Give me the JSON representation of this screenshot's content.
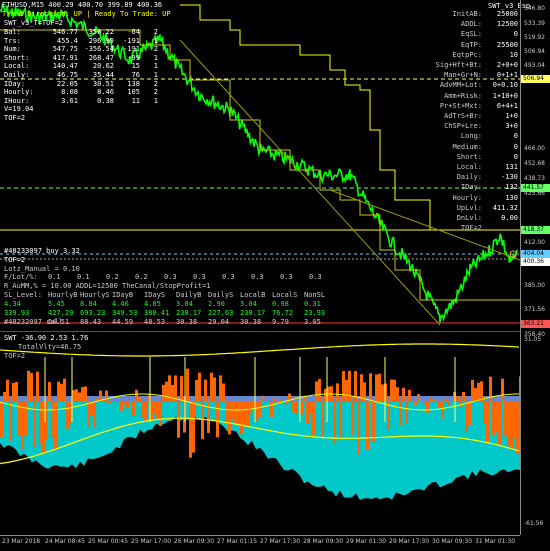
{
  "header": {
    "symbol_line": "ETHUSD,M15  400.29 400.70 399.89 400.36",
    "trend_line": "Trend Direction:  UP  |  Ready To Trade:  UP",
    "indicator_tag": "SWT_v3_Esp"
  },
  "left_panel": {
    "title": "SWT_v3_T=TOF=2",
    "rows": [
      {
        "label": "Bal:",
        "c1": "546.77",
        "c2": "350.22",
        "c3": "-64",
        "c4": "2"
      },
      {
        "label": "Trs:",
        "c1": "455.4",
        "c2": "296.99",
        "c3": "-191",
        "c4": "1"
      },
      {
        "label": "Num:",
        "c1": "547.75",
        "c2": "-356.54",
        "c3": "-191",
        "c4": "2"
      },
      {
        "label": "Short:",
        "c1": "417.91",
        "c2": "268.47",
        "c3": "-99",
        "c4": "1"
      },
      {
        "label": "Local:",
        "c1": "140.47",
        "c2": "20.62",
        "c3": "15",
        "c4": "1"
      },
      {
        "label": "Daily:",
        "c1": "46.75",
        "c2": "35.44",
        "c3": "76",
        "c4": "1"
      },
      {
        "label": "IDay:",
        "c1": "22.05",
        "c2": "30.51",
        "c3": "138",
        "c4": "2"
      },
      {
        "label": "Hourly:",
        "c1": "8.08",
        "c2": "8.46",
        "c3": "105",
        "c4": "2"
      },
      {
        "label": "IHour:",
        "c1": "3.61",
        "c2": "0.38",
        "c3": "11",
        "c4": "1"
      },
      {
        "label": "V=19.04",
        "c1": "",
        "c2": "",
        "c3": "",
        "c4": ""
      },
      {
        "label": "TOF=2",
        "c1": "",
        "c2": "",
        "c3": "",
        "c4": ""
      }
    ]
  },
  "right_panel": {
    "rows": [
      {
        "k": "InitAB:",
        "v": "25000"
      },
      {
        "k": "ADDL:",
        "v": "12500"
      },
      {
        "k": "EqSL:",
        "v": "0"
      },
      {
        "k": "EqTP:",
        "v": "25500"
      },
      {
        "k": "EqtpPc:",
        "v": "10"
      },
      {
        "k": "Sig+Hft+Bt:",
        "v": "2+0+0"
      },
      {
        "k": "Man+Gr+N:",
        "v": "0+1+1"
      },
      {
        "k": "AdvMM+Lot:",
        "v": "0+0.10"
      },
      {
        "k": "Amm+Risk:",
        "v": "1+10+0"
      },
      {
        "k": "Pr+St+Mxt:",
        "v": "6+4+1"
      },
      {
        "k": "AdTrS+Br:",
        "v": "1+0"
      },
      {
        "k": "ChSP+Lre:",
        "v": "3+0"
      },
      {
        "k": "Long:",
        "v": "0"
      },
      {
        "k": "Medium:",
        "v": "0"
      },
      {
        "k": "Short:",
        "v": "0"
      },
      {
        "k": "Local:",
        "v": "131"
      },
      {
        "k": "Daily:",
        "v": "-130"
      },
      {
        "k": "IDay:",
        "v": "132"
      },
      {
        "k": "Hourly:",
        "v": "130"
      },
      {
        "k": "UpLvl:",
        "v": "411.32"
      },
      {
        "k": "DnLvl:",
        "v": "0.00"
      },
      {
        "k": "TOF=2",
        "v": ""
      }
    ]
  },
  "lower_panel": {
    "order_line": "#48233097 buy 3.32",
    "tof": "TOF=2",
    "lots_manual": "Lotz_Manual = 0.10",
    "lots_row": {
      "label": "F/Lot/%:",
      "vals": [
        "0.1",
        "0.1",
        "0.2",
        "0.2",
        "0.3",
        "0.3",
        "0.3",
        "0.3",
        "0.3",
        "0.3"
      ]
    },
    "risk_row": "R_AuMM,% = 10.00        ADDL=12500        TheCanal/StopProfit=1",
    "sl_header": [
      "SL_Level:",
      "HourlyB",
      "HourlyS",
      "IDayB",
      "IDayS",
      "DailyB",
      "DailyS",
      "LocalB",
      "LocalS",
      "NonSL"
    ],
    "sl_row1": [
      "4.34",
      "5.45",
      "8.84",
      "4.46",
      "4.85",
      "3.04",
      "2.90",
      "3.04",
      "0.98",
      "0.31"
    ],
    "sl_row2": [
      "339.93",
      "427.29",
      "693.23",
      "349.53",
      "380.41",
      "238.17",
      "227.63",
      "238.17",
      "76.72",
      "23.93"
    ],
    "sl_row3": [
      "#48232097 sell",
      "54.51",
      "88.43",
      "44.59",
      "48.53",
      "30.38",
      "29.04",
      "30.38",
      "9.79",
      "3.05"
    ]
  },
  "osc_panel": {
    "title": "SWT -36.90 2.53 1.76",
    "line2": "TotalVlty=46.75",
    "line3": "TOF=2"
  },
  "price_axis": {
    "ticks": [
      "546.80",
      "533.39",
      "519.92",
      "506.94",
      "493.04",
      "479.65",
      "466.00",
      "452.68",
      "438.73",
      "425.66",
      "412.00",
      "398.27",
      "385.00",
      "371.56",
      "358.40",
      "31.05",
      "-61.56"
    ],
    "tags": [
      {
        "text": "506.94",
        "color": "#ffff66"
      },
      {
        "text": "441.57",
        "color": "#66ff66"
      },
      {
        "text": "418.37",
        "color": "#66ff66"
      },
      {
        "text": "404.04",
        "color": "#66ccff"
      },
      {
        "text": "400.36",
        "color": "#ffffff"
      },
      {
        "text": "363.21",
        "color": "#ff5555"
      }
    ]
  },
  "time_axis": {
    "labels": [
      "23 Mar 2018",
      "24 Mar 08:45",
      "25 Mar 00:45",
      "25 Mar 17:00",
      "26 Mar 09:30",
      "27 Mar 01:15",
      "27 Mar 17:30",
      "28 Mar 09:30",
      "29 Mar 01:30",
      "29 Mar 17:30",
      "30 Mar 09:30",
      "31 Mar 01:30"
    ]
  },
  "colors": {
    "price_line": "#00ff00",
    "channel": "#ffff00",
    "resistance": "#c8c800",
    "osc_cyan": "#00c8c8",
    "osc_orange": "#ff6600",
    "osc_blue": "#6688cc",
    "sell_line": "#ff3333"
  }
}
